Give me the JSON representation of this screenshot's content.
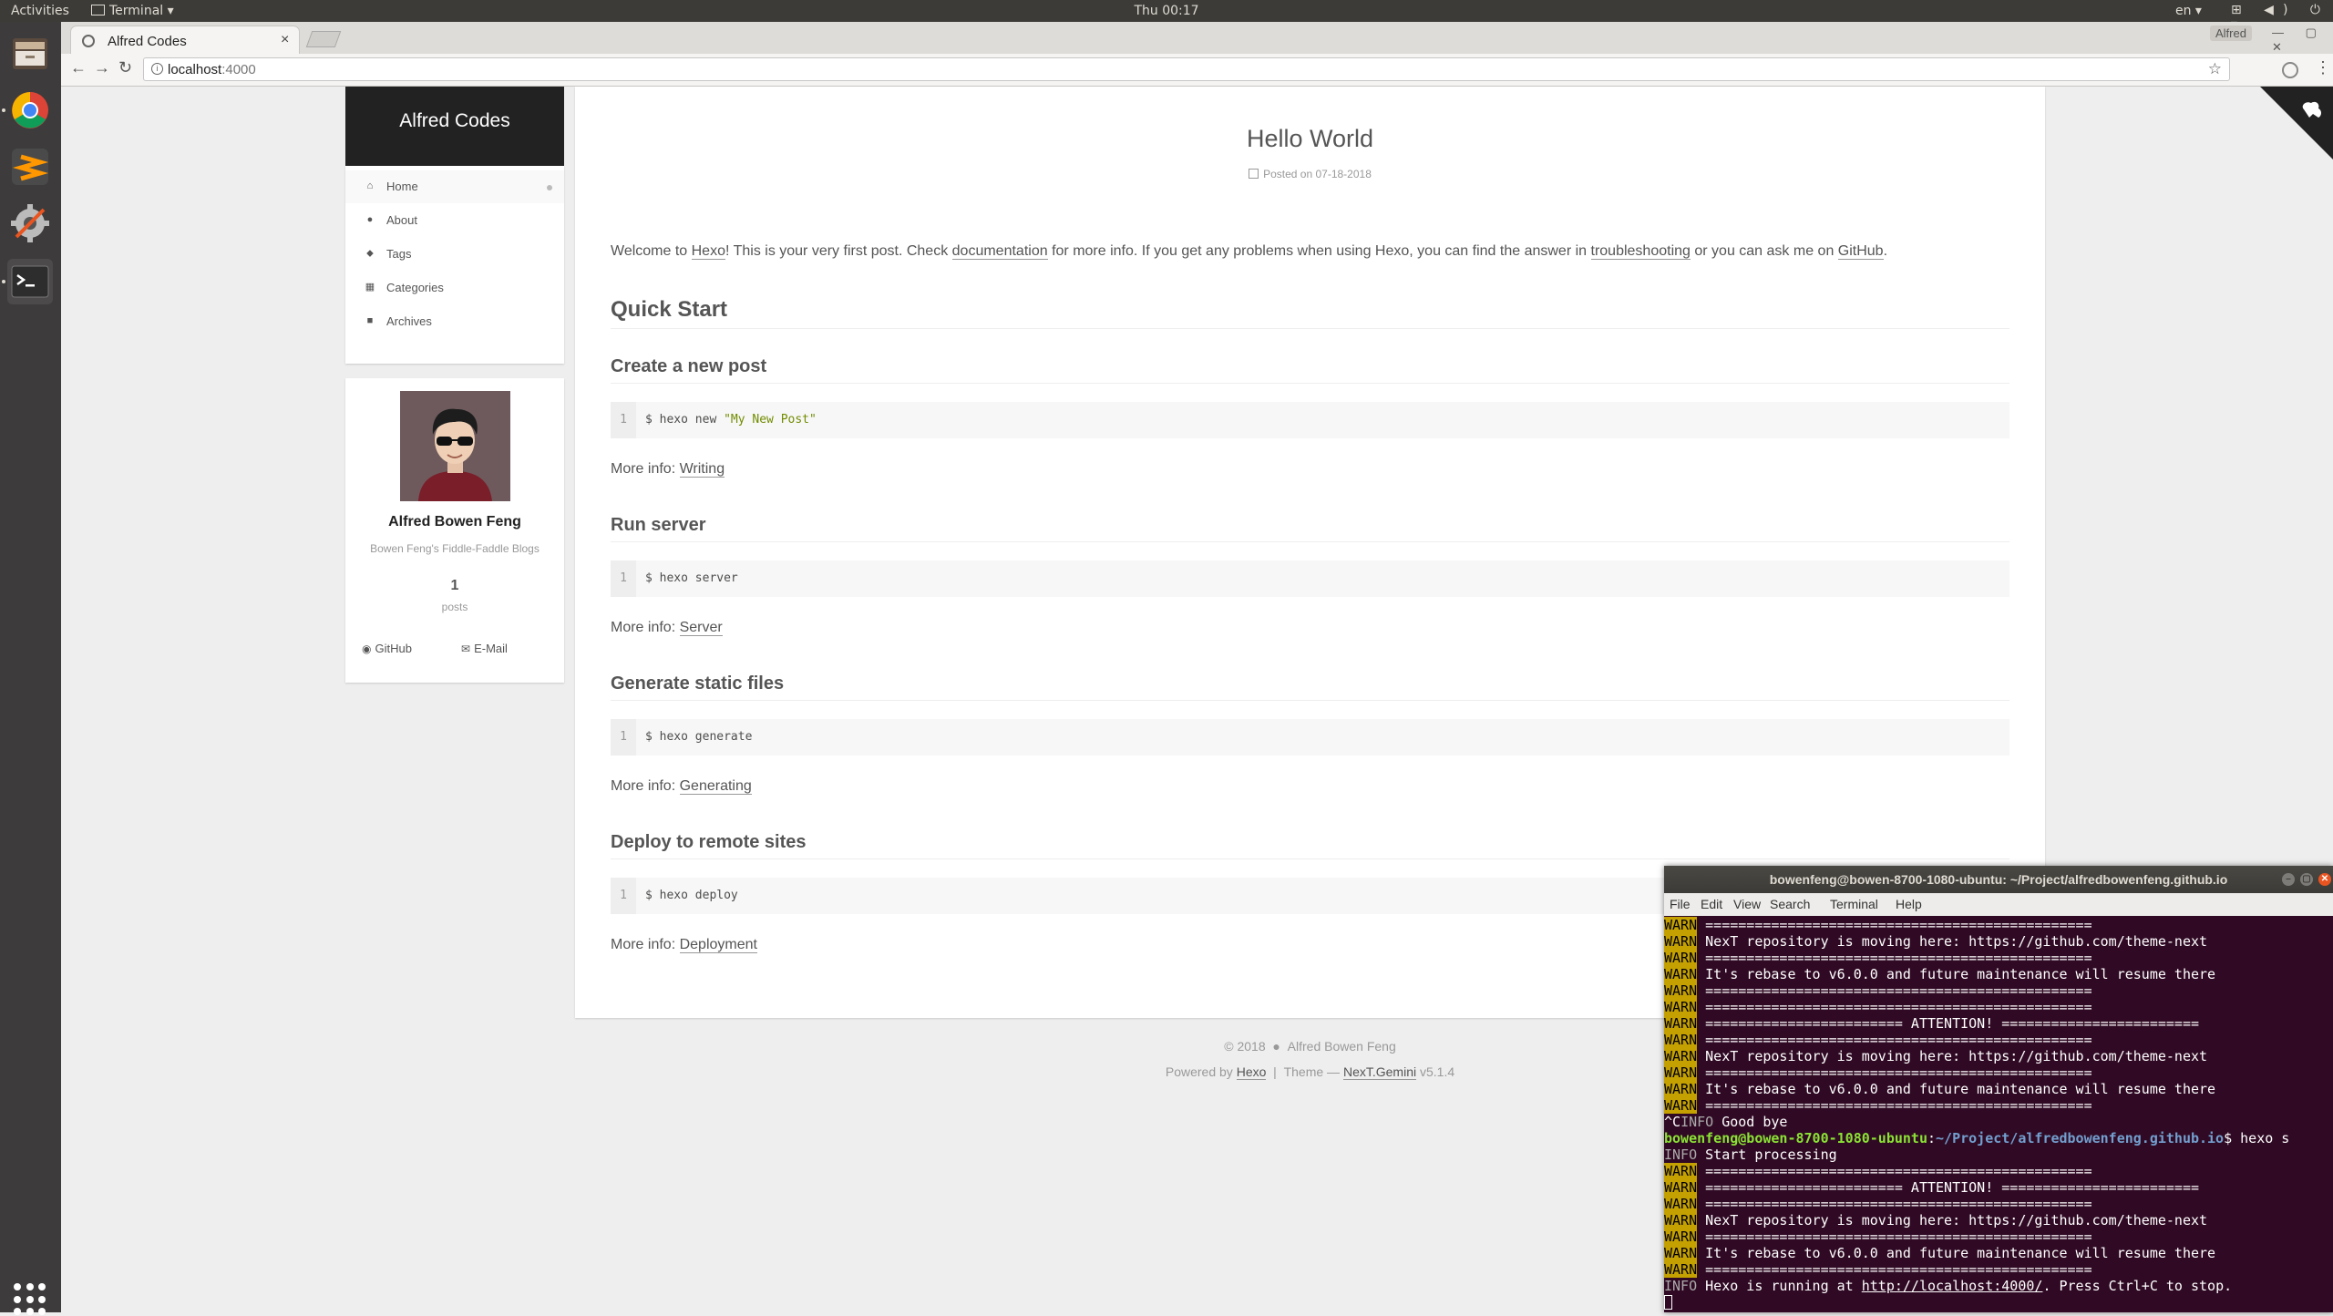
{
  "topbar": {
    "activities": "Activities",
    "app_menu": "Terminal ▾",
    "clock": "Thu 00:17",
    "language": "en ▾",
    "tray": "⊞ ◀) ⏻ ▾"
  },
  "dock": {
    "apps": [
      "files",
      "chrome",
      "sublime-text",
      "settings",
      "terminal"
    ]
  },
  "browser": {
    "tab_title": "Alfred Codes",
    "tab_close": "×",
    "profile": "Alfred",
    "window_controls": "— ▢ ✕",
    "back": "←",
    "forward": "→",
    "reload": "↻",
    "url_host": "localhost",
    "url_port": ":4000",
    "bookmark": "☆",
    "menu": "⋮"
  },
  "site": {
    "brand": "Alfred Codes",
    "menu": [
      {
        "label": "Home",
        "icon": "home-icon",
        "glyph": "⌂"
      },
      {
        "label": "About",
        "icon": "user-icon",
        "glyph": "●"
      },
      {
        "label": "Tags",
        "icon": "tags-icon",
        "glyph": "⬥"
      },
      {
        "label": "Categories",
        "icon": "grid-icon",
        "glyph": "▦"
      },
      {
        "label": "Archives",
        "icon": "archive-icon",
        "glyph": "■"
      }
    ],
    "author": "Alfred Bowen Feng",
    "description": "Bowen Feng's Fiddle-Faddle Blogs",
    "posts_count": "1",
    "posts_label": "posts",
    "social": {
      "github": "GitHub",
      "email": "E-Mail"
    }
  },
  "post": {
    "title": "Hello World",
    "meta": "Posted on 07-18-2018",
    "intro": {
      "t1": "Welcome to ",
      "a1": "Hexo",
      "t2": "! This is your very first post. Check ",
      "a2": "documentation",
      "t3": " for more info. If you get any problems when using Hexo, you can find the answer in ",
      "a3": "troubleshooting",
      "t4": " or you can ask me on ",
      "a4": "GitHub",
      "t5": "."
    },
    "quick_start": "Quick Start",
    "more_info": "More info: ",
    "sections": [
      {
        "heading": "Create a new post",
        "line": "1",
        "code": "$ hexo new ",
        "code_str": "\"My New Post\"",
        "link": "Writing"
      },
      {
        "heading": "Run server",
        "line": "1",
        "code": "$ hexo server",
        "code_str": "",
        "link": "Server"
      },
      {
        "heading": "Generate static files",
        "line": "1",
        "code": "$ hexo generate",
        "code_str": "",
        "link": "Generating"
      },
      {
        "heading": "Deploy to remote sites",
        "line": "1",
        "code": "$ hexo deploy",
        "code_str": "",
        "link": "Deployment"
      }
    ]
  },
  "footer": {
    "copyright": "© 2018",
    "author": "Alfred Bowen Feng",
    "powered_by": "Powered by ",
    "hexo": "Hexo",
    "sep": "|",
    "theme_label": "Theme — ",
    "theme": "NexT.Gemini",
    "version": "v5.1.4"
  },
  "terminal": {
    "title": "bowenfeng@bowen-8700-1080-ubuntu: ~/Project/alfredbowenfeng.github.io",
    "menu": [
      "File",
      "Edit",
      "View",
      "Search",
      "Terminal",
      "Help"
    ],
    "prompt_user": "bowenfeng@bowen-8700-1080-ubuntu",
    "prompt_path": "~/Project/alfredbowenfeng.github.io",
    "command": "$ hexo s",
    "lines": {
      "rule": " ===============================================",
      "moving": " NexT repository is moving here: https://github.com/theme-next",
      "rebase": " It's rebase to v6.0.0 and future maintenance will resume there",
      "attention": " ======================== ATTENTION! ========================",
      "goodbye_prefix": "^C",
      "goodbye": " Good bye",
      "start": " Start processing",
      "running_pre": " Hexo is running at ",
      "running_url": "http://localhost:4000/",
      "running_post": ". Press Ctrl+C to stop.",
      "warn": "WARN",
      "info": "INFO"
    }
  }
}
